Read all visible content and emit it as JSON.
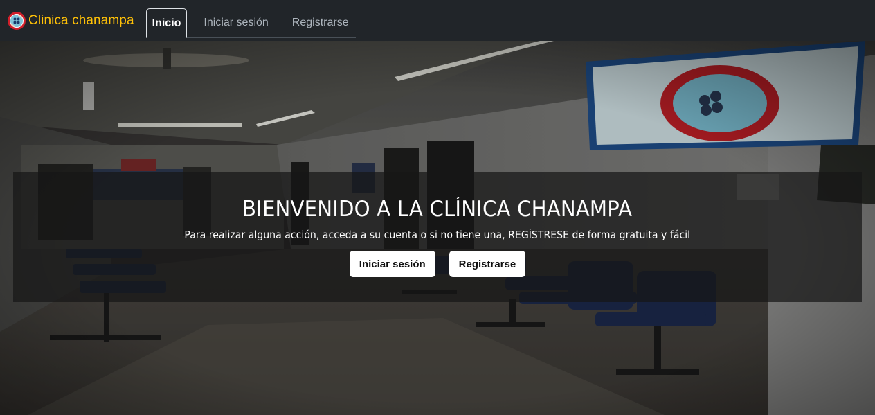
{
  "navbar": {
    "brand": {
      "text": "Clinica chanampa",
      "logo_icon": "clinic-logo-icon",
      "color": "#ffc107"
    },
    "links": [
      {
        "label": "Inicio",
        "active": true
      },
      {
        "label": "Iniciar sesión",
        "active": false
      },
      {
        "label": "Registrarse",
        "active": false
      }
    ]
  },
  "hero": {
    "title": "BIENVENIDO A LA CLÍNICA CHANAMPA",
    "subtitle": "Para realizar alguna acción, acceda a su cuenta o si no tiene una, REGÍSTRESE de forma gratuita y fácil",
    "buttons": {
      "login": "Iniciar sesión",
      "register": "Registrarse"
    },
    "background": "clinic-waiting-room-photo"
  },
  "colors": {
    "navbar_bg": "#212529",
    "brand": "#ffc107",
    "nav_inactive": "#adb5bd",
    "button_bg": "#ffffff"
  }
}
